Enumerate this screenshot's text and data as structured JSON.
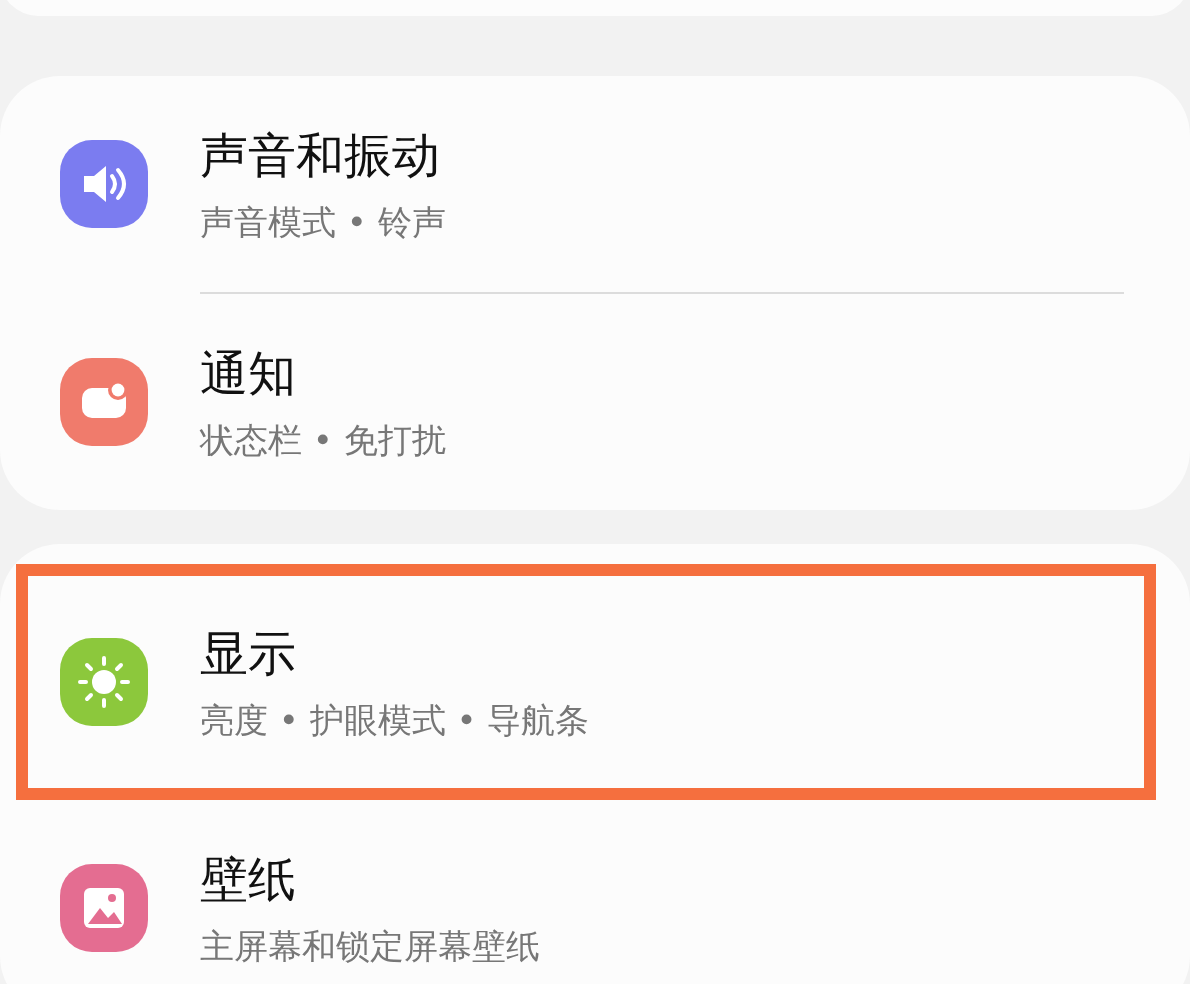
{
  "groups": [
    {
      "items": [
        {
          "title": "声音和振动",
          "subtitle": "声音模式 • 铃声",
          "highlighted": false
        },
        {
          "title": "通知",
          "subtitle": "状态栏 • 免打扰",
          "highlighted": false
        }
      ]
    },
    {
      "items": [
        {
          "title": "显示",
          "subtitle": "亮度 • 护眼模式 • 导航条",
          "highlighted": true
        },
        {
          "title": "壁纸",
          "subtitle": "主屏幕和锁定屏幕壁纸",
          "highlighted": false
        }
      ]
    }
  ]
}
